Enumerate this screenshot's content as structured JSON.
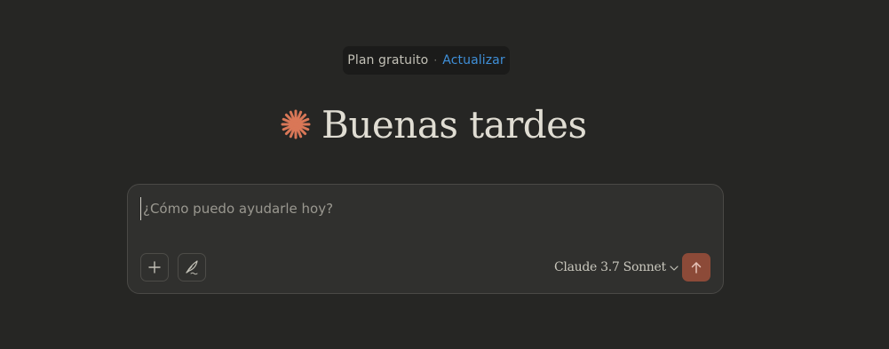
{
  "plan_banner": {
    "label": "Plan gratuito",
    "separator": "·",
    "upgrade_link": "Actualizar"
  },
  "greeting": {
    "text": "Buenas tardes",
    "icon": "spark-logo-icon",
    "accent_color": "#d97757"
  },
  "composer": {
    "placeholder": "¿Cómo puedo ayudarle hoy?",
    "value": "",
    "add_icon": "plus-icon",
    "style_icon": "quill-icon",
    "model_selector": {
      "selected": "Claude 3.7 Sonnet",
      "icon": "chevron-down-icon"
    },
    "send_icon": "arrow-up-icon",
    "send_color": "#8c4a38"
  },
  "colors": {
    "background": "#262624",
    "composer_bg": "#30302e",
    "link": "#3f8fd8"
  }
}
